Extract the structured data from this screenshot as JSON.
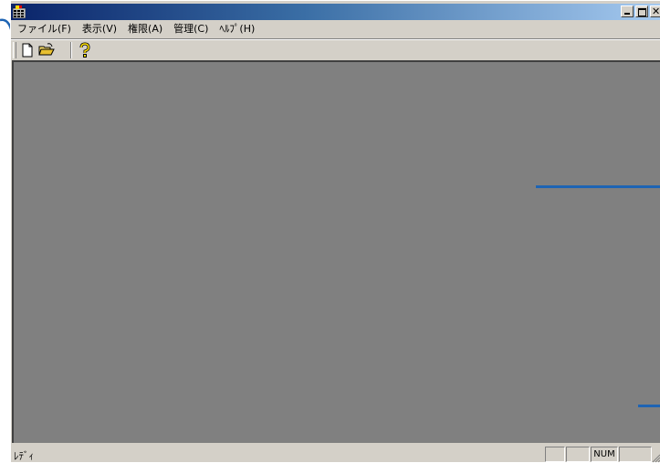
{
  "titlebar": {
    "title": "",
    "icon": "app-grid-icon",
    "colors": {
      "start": "#0a246a",
      "end": "#a6caf0"
    }
  },
  "window_controls": {
    "minimize": "minimize-icon",
    "maximize": "maximize-icon",
    "close": "close-icon"
  },
  "menu": {
    "items": [
      {
        "label": "ファイル(F)"
      },
      {
        "label": "表示(V)"
      },
      {
        "label": "権限(A)"
      },
      {
        "label": "管理(C)"
      },
      {
        "label": "ﾍﾙﾌﾟ(H)"
      }
    ]
  },
  "toolbar": {
    "buttons": [
      {
        "icon": "new-document-icon"
      },
      {
        "icon": "open-folder-icon"
      },
      {
        "icon": "help-icon"
      }
    ]
  },
  "workspace": {
    "background": "#808080",
    "accent": "#1e64b4"
  },
  "statusbar": {
    "text": "ﾚﾃﾞｨ",
    "panes": [
      "",
      "",
      "NUM",
      ""
    ]
  }
}
